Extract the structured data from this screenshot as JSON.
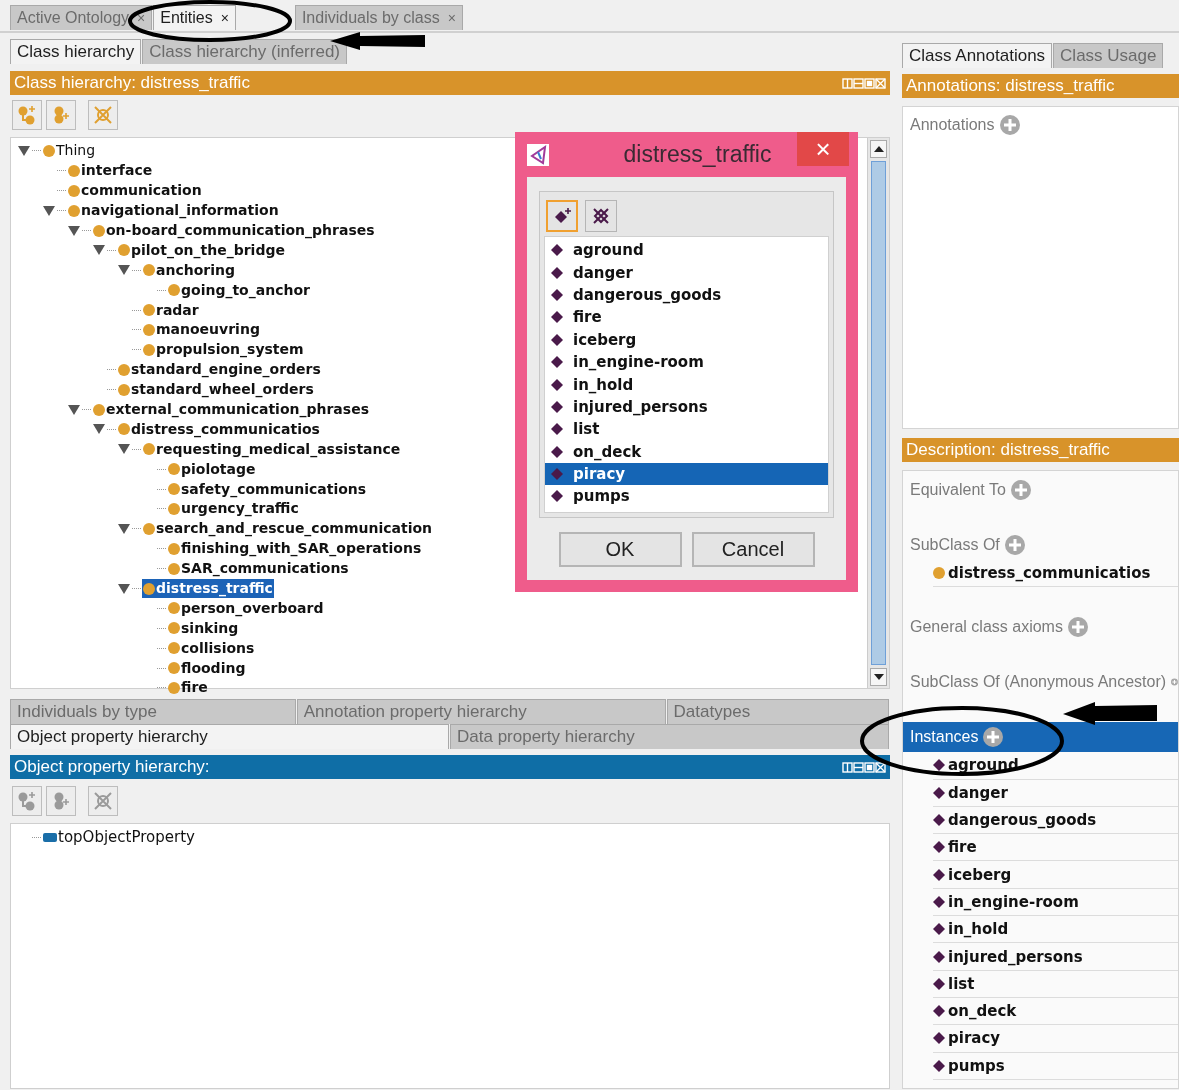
{
  "tabs": [
    {
      "label": "Active Ontology",
      "close": "×",
      "selected": false
    },
    {
      "label": "Entities",
      "close": "×",
      "selected": true
    },
    {
      "label": "Individuals by class",
      "close": "×",
      "selected": false
    }
  ],
  "class_hierarchy": {
    "tabs": [
      {
        "label": "Class hierarchy",
        "selected": true
      },
      {
        "label": "Class hierarchy (inferred)",
        "selected": false
      }
    ],
    "header": "Class hierarchy: distress_traffic",
    "tree": [
      {
        "label": "Thing",
        "selected": false,
        "children": [
          {
            "label": "interface",
            "selected": false
          },
          {
            "label": "communication",
            "selected": false
          },
          {
            "label": "navigational_information",
            "selected": false,
            "children": [
              {
                "label": "on-board_communication_phrases",
                "selected": false,
                "children": [
                  {
                    "label": "pilot_on_the_bridge",
                    "selected": false,
                    "children": [
                      {
                        "label": "anchoring",
                        "selected": false,
                        "children": [
                          {
                            "label": "going_to_anchor",
                            "selected": false
                          }
                        ]
                      },
                      {
                        "label": "radar",
                        "selected": false
                      },
                      {
                        "label": "manoeuvring",
                        "selected": false
                      },
                      {
                        "label": "propulsion_system",
                        "selected": false
                      }
                    ]
                  },
                  {
                    "label": "standard_engine_orders",
                    "selected": false
                  },
                  {
                    "label": "standard_wheel_orders",
                    "selected": false
                  }
                ]
              },
              {
                "label": "external_communication_phrases",
                "selected": false,
                "children": [
                  {
                    "label": "distress_communicatios",
                    "selected": false,
                    "children": [
                      {
                        "label": "requesting_medical_assistance",
                        "selected": false,
                        "children": [
                          {
                            "label": "piolotage",
                            "selected": false
                          },
                          {
                            "label": "safety_communications",
                            "selected": false
                          },
                          {
                            "label": "urgency_traffic",
                            "selected": false
                          }
                        ]
                      },
                      {
                        "label": "search_and_rescue_communication",
                        "selected": false,
                        "children": [
                          {
                            "label": "finishing_with_SAR_operations",
                            "selected": false
                          },
                          {
                            "label": "SAR_communications",
                            "selected": false
                          }
                        ]
                      },
                      {
                        "label": "distress_traffic",
                        "selected": true,
                        "children": [
                          {
                            "label": "person_overboard",
                            "selected": false
                          },
                          {
                            "label": "sinking",
                            "selected": false
                          },
                          {
                            "label": "collisions",
                            "selected": false
                          },
                          {
                            "label": "flooding",
                            "selected": false
                          },
                          {
                            "label": "fire",
                            "selected": false
                          }
                        ]
                      }
                    ]
                  }
                ]
              }
            ]
          }
        ]
      }
    ]
  },
  "bottom_views": {
    "tab_rows": [
      [
        {
          "label": "Individuals by type",
          "selected": false
        },
        {
          "label": "Annotation property hierarchy",
          "selected": false
        },
        {
          "label": "Datatypes",
          "selected": false
        }
      ],
      [
        {
          "label": "Object property hierarchy",
          "selected": true
        },
        {
          "label": "Data property hierarchy",
          "selected": false
        }
      ]
    ],
    "header": "Object property hierarchy:",
    "tree": [
      {
        "label": "topObjectProperty",
        "selected": false
      }
    ]
  },
  "right": {
    "tabs": [
      {
        "label": "Class Annotations",
        "selected": true
      },
      {
        "label": "Class Usage",
        "selected": false
      }
    ],
    "annotations": {
      "header": "Annotations: distress_traffic",
      "label": "Annotations"
    },
    "description": {
      "header": "Description: distress_traffic",
      "sections": [
        {
          "label": "Equivalent To",
          "selected": false
        },
        {
          "label": "SubClass Of",
          "selected": false,
          "items": [
            {
              "label": "distress_communicatios",
              "kind": "class"
            }
          ]
        },
        {
          "label": "General class axioms",
          "selected": false
        },
        {
          "label": "SubClass Of (Anonymous Ancestor)",
          "selected": false
        },
        {
          "label": "Instances",
          "selected": true,
          "items": [
            {
              "label": "aground",
              "kind": "individual"
            },
            {
              "label": "danger",
              "kind": "individual"
            },
            {
              "label": "dangerous_goods",
              "kind": "individual"
            },
            {
              "label": "fire",
              "kind": "individual"
            },
            {
              "label": "iceberg",
              "kind": "individual"
            },
            {
              "label": "in_engine-room",
              "kind": "individual"
            },
            {
              "label": "in_hold",
              "kind": "individual"
            },
            {
              "label": "injured_persons",
              "kind": "individual"
            },
            {
              "label": "list",
              "kind": "individual"
            },
            {
              "label": "on_deck",
              "kind": "individual"
            },
            {
              "label": "piracy",
              "kind": "individual"
            },
            {
              "label": "pumps",
              "kind": "individual"
            }
          ]
        }
      ]
    }
  },
  "dialog": {
    "title": "distress_traffic",
    "close": "×",
    "items": [
      {
        "label": "aground",
        "selected": false
      },
      {
        "label": "danger",
        "selected": false
      },
      {
        "label": "dangerous_goods",
        "selected": false
      },
      {
        "label": "fire",
        "selected": false
      },
      {
        "label": "iceberg",
        "selected": false
      },
      {
        "label": "in_engine-room",
        "selected": false
      },
      {
        "label": "in_hold",
        "selected": false
      },
      {
        "label": "injured_persons",
        "selected": false
      },
      {
        "label": "list",
        "selected": false
      },
      {
        "label": "on_deck",
        "selected": false
      },
      {
        "label": "piracy",
        "selected": true
      },
      {
        "label": "pumps",
        "selected": false
      }
    ],
    "buttons": [
      "OK",
      "Cancel"
    ]
  }
}
